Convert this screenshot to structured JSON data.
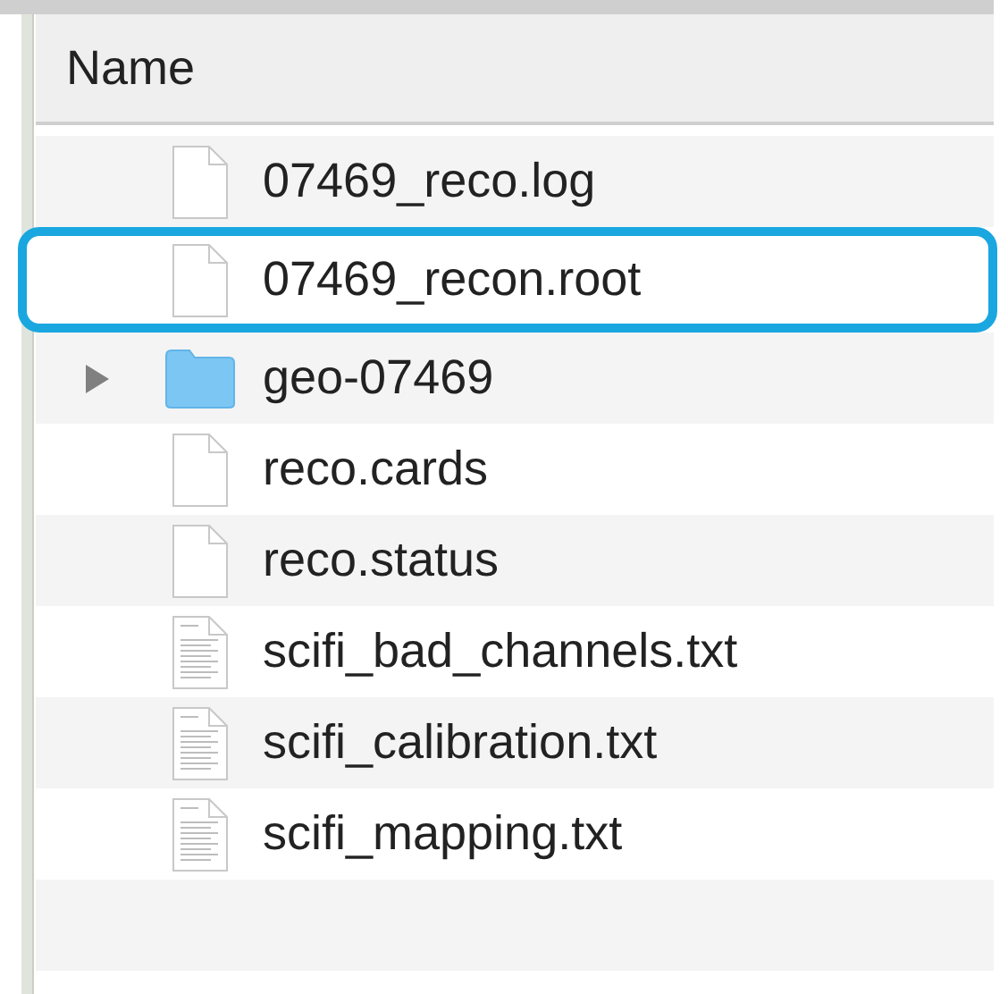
{
  "header": {
    "label": "Name"
  },
  "rows": [
    {
      "name": "07469_reco.log",
      "kind": "blank",
      "highlighted": false
    },
    {
      "name": "07469_recon.root",
      "kind": "blank",
      "highlighted": true
    },
    {
      "name": "geo-07469",
      "kind": "folder",
      "expanded": false,
      "highlighted": false
    },
    {
      "name": "reco.cards",
      "kind": "blank",
      "highlighted": false
    },
    {
      "name": "reco.status",
      "kind": "blank",
      "highlighted": false
    },
    {
      "name": "scifi_bad_channels.txt",
      "kind": "text",
      "highlighted": false
    },
    {
      "name": "scifi_calibration.txt",
      "kind": "text",
      "highlighted": false
    },
    {
      "name": "scifi_mapping.txt",
      "kind": "text",
      "highlighted": false
    }
  ]
}
